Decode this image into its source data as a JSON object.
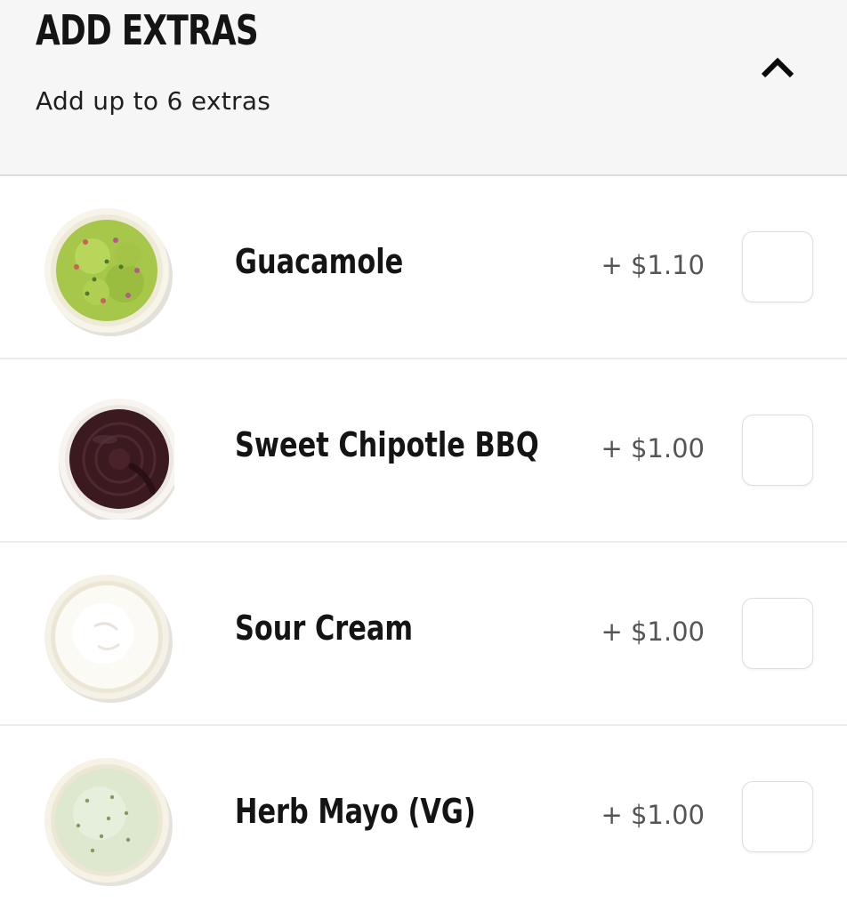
{
  "header": {
    "title": "ADD EXTRAS",
    "subtitle": "Add up to 6 extras",
    "toggle_icon": "chevron-up-icon"
  },
  "colors": {
    "header_bg": "#f6f6f6",
    "text_primary": "#141414",
    "price_text": "#555555",
    "checkbox_border": "#dedede"
  },
  "extras": [
    {
      "name": "Guacamole",
      "price": "+ $1.10",
      "image": "guacamole-bowl",
      "checked": false
    },
    {
      "name": "Sweet Chipotle BBQ",
      "price": "+ $1.00",
      "image": "bbq-sauce-bowl",
      "checked": false
    },
    {
      "name": "Sour Cream",
      "price": "+ $1.00",
      "image": "sour-cream-bowl",
      "checked": false
    },
    {
      "name": "Herb Mayo (VG)",
      "price": "+ $1.00",
      "image": "herb-mayo-bowl",
      "checked": false
    }
  ]
}
